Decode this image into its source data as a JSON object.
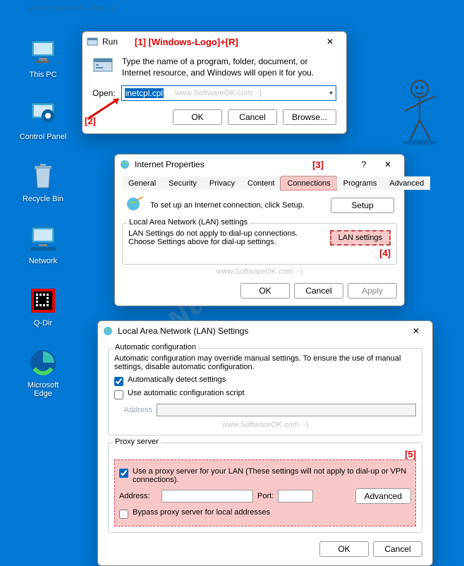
{
  "watermarks": {
    "url": "www.SoftwareOK.com :-)",
    "big": "SoftwareOK.com"
  },
  "desktop": {
    "this_pc": "This PC",
    "control_panel": "Control Panel",
    "recycle_bin": "Recycle Bin",
    "network": "Network",
    "qdir": "Q-Dir",
    "edge": "Microsoft Edge"
  },
  "annotations": {
    "a1": "[1]  [Windows-Logo]+[R]",
    "a2": "[2]",
    "a3": "[3]",
    "a4": "[4]",
    "a5": "[5]"
  },
  "run": {
    "title": "Run",
    "desc": "Type the name of a program, folder, document, or Internet resource, and Windows will open it for you.",
    "open_label": "Open:",
    "value": "inetcpl.cpl",
    "ok": "OK",
    "cancel": "Cancel",
    "browse": "Browse..."
  },
  "ip": {
    "title": "Internet Properties",
    "tabs": {
      "general": "General",
      "security": "Security",
      "privacy": "Privacy",
      "content": "Content",
      "connections": "Connections",
      "programs": "Programs",
      "advanced": "Advanced"
    },
    "setup_text": "To set up an Internet connection, click Setup.",
    "setup_btn": "Setup",
    "lan_legend": "Local Area Network (LAN) settings",
    "lan_text": "LAN Settings do not apply to dial-up connections. Choose Settings above for dial-up settings.",
    "lan_btn": "LAN settings",
    "ok": "OK",
    "cancel": "Cancel",
    "apply": "Apply"
  },
  "lan": {
    "title": "Local Area Network (LAN) Settings",
    "auto_legend": "Automatic configuration",
    "auto_desc": "Automatic configuration may override manual settings.  To ensure the use of manual settings, disable automatic configuration.",
    "auto_detect": "Automatically detect settings",
    "auto_script": "Use automatic configuration script",
    "address_label": "Address",
    "proxy_legend": "Proxy server",
    "proxy_use": "Use a proxy server for your LAN (These settings will not apply to dial-up or VPN connections).",
    "addr": "Address:",
    "port": "Port:",
    "advanced": "Advanced",
    "bypass": "Bypass proxy server for local addresses",
    "ok": "OK",
    "cancel": "Cancel"
  }
}
